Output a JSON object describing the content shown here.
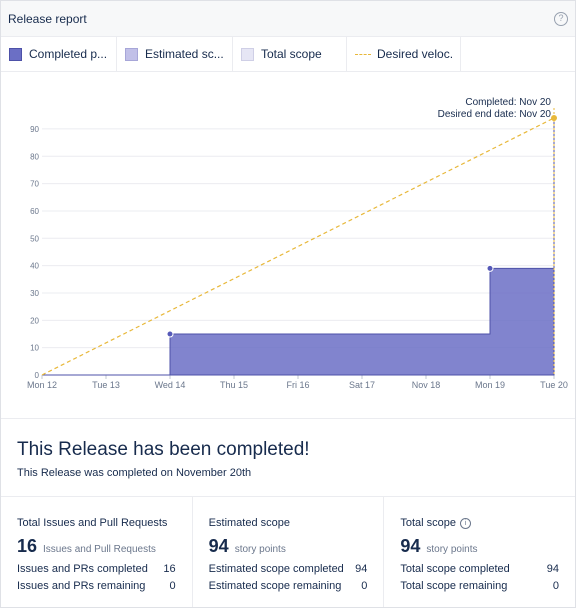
{
  "header": {
    "title": "Release report",
    "help_icon": "question-circle-icon"
  },
  "legend": [
    {
      "label": "Completed p...",
      "color": "#6b6fc5"
    },
    {
      "label": "Estimated sc...",
      "color": "#c1c0e8"
    },
    {
      "label": "Total scope",
      "color": "#e6e6f5"
    },
    {
      "label": "Desired veloc...",
      "color": "#e8b83a"
    }
  ],
  "chart_data": {
    "type": "area",
    "annotations": [
      "Completed: Nov 20",
      "Desired end date: Nov 20"
    ],
    "categories": [
      "Mon 12",
      "Tue 13",
      "Wed 14",
      "Thu 15",
      "Fri 16",
      "Sat 17",
      "Nov 18",
      "Mon 19",
      "Tue 20"
    ],
    "y_ticks": [
      0,
      10,
      20,
      30,
      40,
      50,
      60,
      70,
      80,
      90
    ],
    "ylim": [
      0,
      94
    ],
    "grid": true,
    "series": [
      {
        "name": "Completed",
        "type": "step-area",
        "color": "#6b6fc5",
        "points": [
          [
            0,
            0
          ],
          [
            2,
            15
          ],
          [
            7,
            39
          ],
          [
            8,
            94
          ]
        ]
      },
      {
        "name": "Desired velocity",
        "type": "dashed-line",
        "color": "#e8b83a",
        "points": [
          [
            0,
            0
          ],
          [
            8,
            94
          ]
        ]
      }
    ]
  },
  "summary": {
    "title": "This Release has been completed!",
    "subtitle": "This Release was completed on November 20th"
  },
  "stats": [
    {
      "title": "Total Issues and Pull Requests",
      "info": false,
      "number": "16",
      "unit": "Issues and Pull Requests",
      "rows": [
        {
          "label": "Issues and PRs completed",
          "value": "16"
        },
        {
          "label": "Issues and PRs remaining",
          "value": "0"
        }
      ]
    },
    {
      "title": "Estimated scope",
      "info": false,
      "number": "94",
      "unit": "story points",
      "rows": [
        {
          "label": "Estimated scope completed",
          "value": "94"
        },
        {
          "label": "Estimated scope remaining",
          "value": "0"
        }
      ]
    },
    {
      "title": "Total scope",
      "info": true,
      "number": "94",
      "unit": "story points",
      "rows": [
        {
          "label": "Total scope completed",
          "value": "94"
        },
        {
          "label": "Total scope remaining",
          "value": "0"
        }
      ]
    }
  ]
}
